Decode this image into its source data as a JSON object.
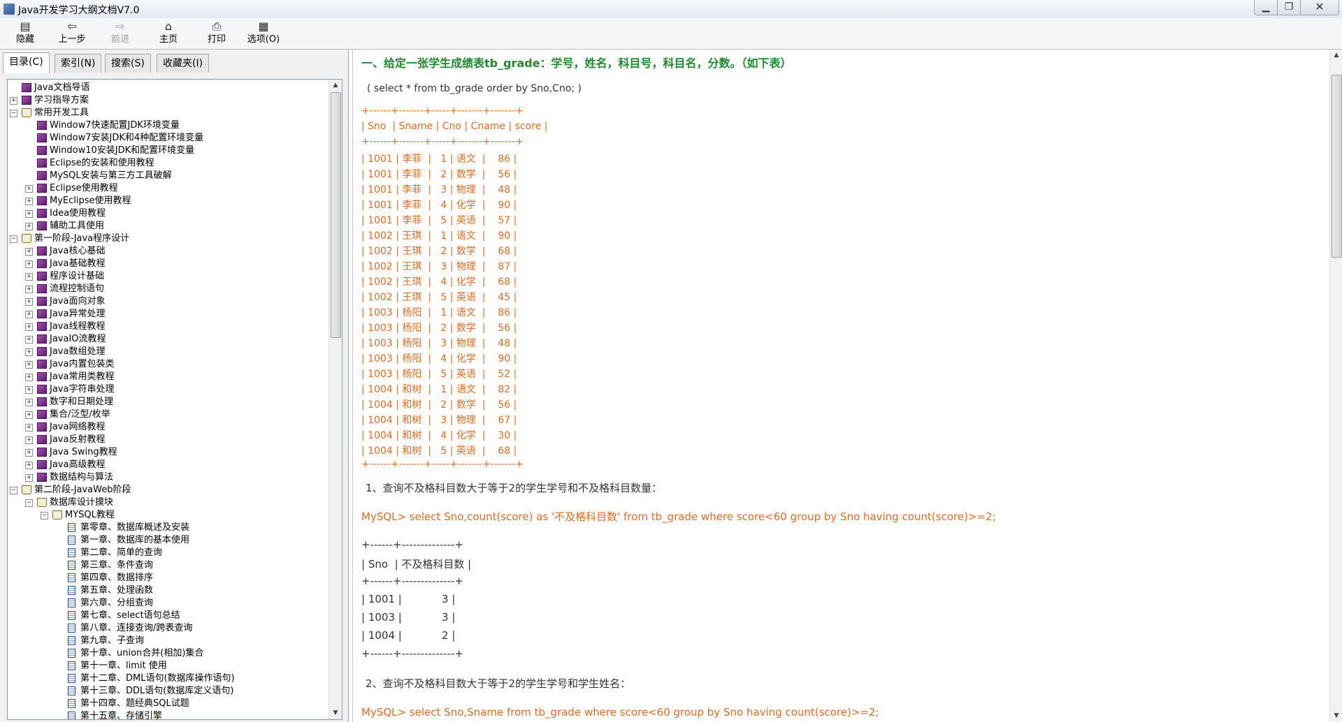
{
  "window": {
    "title": "Java开发学习大纲文档V7.0",
    "min": "▁",
    "max": "❐",
    "close": "✕"
  },
  "toolbar": [
    {
      "label": "隐藏",
      "icon": "▤",
      "enabled": true
    },
    {
      "label": "上一步",
      "icon": "⇦",
      "enabled": true
    },
    {
      "label": "前进",
      "icon": "⇨",
      "enabled": false
    },
    {
      "label": "主页",
      "icon": "⌂",
      "enabled": true
    },
    {
      "label": "打印",
      "icon": "⎙",
      "enabled": true
    },
    {
      "label": "选项(O)",
      "icon": "▦",
      "enabled": true
    }
  ],
  "nav_tabs": [
    {
      "label": "目录(C)",
      "active": true
    },
    {
      "label": "索引(N)",
      "active": false
    },
    {
      "label": "搜索(S)",
      "active": false
    },
    {
      "label": "收藏夹(I)",
      "active": false
    }
  ],
  "tree": [
    {
      "label": "Java文档导语",
      "level": 0,
      "toggle": "",
      "icon": "book"
    },
    {
      "label": "学习指导方案",
      "level": 0,
      "toggle": "+",
      "icon": "book"
    },
    {
      "label": "常用开发工具",
      "level": 0,
      "toggle": "-",
      "icon": "open"
    },
    {
      "label": "Window7快速配置JDK环境变量",
      "level": 1,
      "toggle": "",
      "icon": "book"
    },
    {
      "label": "Window7安装JDK和4种配置环境变量",
      "level": 1,
      "toggle": "",
      "icon": "book"
    },
    {
      "label": "Window10安装JDK和配置环境变量",
      "level": 1,
      "toggle": "",
      "icon": "book"
    },
    {
      "label": "Eclipse的安装和使用教程",
      "level": 1,
      "toggle": "",
      "icon": "book"
    },
    {
      "label": "MySQL安装与第三方工具破解",
      "level": 1,
      "toggle": "",
      "icon": "book"
    },
    {
      "label": "Eclipse使用教程",
      "level": 1,
      "toggle": "+",
      "icon": "book"
    },
    {
      "label": "MyEclipse使用教程",
      "level": 1,
      "toggle": "+",
      "icon": "book"
    },
    {
      "label": "Idea使用教程",
      "level": 1,
      "toggle": "+",
      "icon": "book"
    },
    {
      "label": "辅助工具使用",
      "level": 1,
      "toggle": "+",
      "icon": "book"
    },
    {
      "label": "第一阶段-Java程序设计",
      "level": 0,
      "toggle": "-",
      "icon": "open"
    },
    {
      "label": "Java核心基础",
      "level": 1,
      "toggle": "+",
      "icon": "book"
    },
    {
      "label": "Java基础教程",
      "level": 1,
      "toggle": "+",
      "icon": "book"
    },
    {
      "label": "程序设计基础",
      "level": 1,
      "toggle": "+",
      "icon": "book"
    },
    {
      "label": "流程控制语句",
      "level": 1,
      "toggle": "+",
      "icon": "book"
    },
    {
      "label": "Java面向对象",
      "level": 1,
      "toggle": "+",
      "icon": "book"
    },
    {
      "label": "Java异常处理",
      "level": 1,
      "toggle": "+",
      "icon": "book"
    },
    {
      "label": "Java线程教程",
      "level": 1,
      "toggle": "+",
      "icon": "book"
    },
    {
      "label": "JavaIO流教程",
      "level": 1,
      "toggle": "+",
      "icon": "book"
    },
    {
      "label": "Java数组处理",
      "level": 1,
      "toggle": "+",
      "icon": "book"
    },
    {
      "label": "Java内置包装类",
      "level": 1,
      "toggle": "+",
      "icon": "book"
    },
    {
      "label": "Java常用类教程",
      "level": 1,
      "toggle": "+",
      "icon": "book"
    },
    {
      "label": "Java字符串处理",
      "level": 1,
      "toggle": "+",
      "icon": "book"
    },
    {
      "label": "数字和日期处理",
      "level": 1,
      "toggle": "+",
      "icon": "book"
    },
    {
      "label": "集合/泛型/枚举",
      "level": 1,
      "toggle": "+",
      "icon": "book"
    },
    {
      "label": "Java网络教程",
      "level": 1,
      "toggle": "+",
      "icon": "book"
    },
    {
      "label": "Java反射教程",
      "level": 1,
      "toggle": "+",
      "icon": "book"
    },
    {
      "label": "Java Swing教程",
      "level": 1,
      "toggle": "+",
      "icon": "book"
    },
    {
      "label": "Java高级教程",
      "level": 1,
      "toggle": "+",
      "icon": "book"
    },
    {
      "label": "数据结构与算法",
      "level": 1,
      "toggle": "+",
      "icon": "book"
    },
    {
      "label": "第二阶段-JavaWeb阶段",
      "level": 0,
      "toggle": "-",
      "icon": "open"
    },
    {
      "label": "数据库设计摸块",
      "level": 1,
      "toggle": "-",
      "icon": "open"
    },
    {
      "label": "MYSQL教程",
      "level": 2,
      "toggle": "-",
      "icon": "open"
    },
    {
      "label": "第零章、数据库概述及安装",
      "level": 3,
      "toggle": "",
      "icon": "page"
    },
    {
      "label": "第一章、数据库的基本使用",
      "level": 3,
      "toggle": "",
      "icon": "page"
    },
    {
      "label": "第二章、简单的查询",
      "level": 3,
      "toggle": "",
      "icon": "page"
    },
    {
      "label": "第三章、条件查询",
      "level": 3,
      "toggle": "",
      "icon": "page"
    },
    {
      "label": "第四章、数据排序",
      "level": 3,
      "toggle": "",
      "icon": "page"
    },
    {
      "label": "第五章、处理函数",
      "level": 3,
      "toggle": "",
      "icon": "page"
    },
    {
      "label": "第六章、分组查询",
      "level": 3,
      "toggle": "",
      "icon": "page"
    },
    {
      "label": "第七章、select语句总结",
      "level": 3,
      "toggle": "",
      "icon": "page"
    },
    {
      "label": "第八章、连接查询/跨表查询",
      "level": 3,
      "toggle": "",
      "icon": "page"
    },
    {
      "label": "第九章、子查询",
      "level": 3,
      "toggle": "",
      "icon": "page"
    },
    {
      "label": "第十章、union合并(相加)集合",
      "level": 3,
      "toggle": "",
      "icon": "page"
    },
    {
      "label": "第十一章、limit 使用",
      "level": 3,
      "toggle": "",
      "icon": "page"
    },
    {
      "label": "第十二章、DML语句(数据库操作语句)",
      "level": 3,
      "toggle": "",
      "icon": "page"
    },
    {
      "label": "第十三章、DDL语句(数据库定义语句)",
      "level": 3,
      "toggle": "",
      "icon": "page"
    },
    {
      "label": "第十四章、题经典SQL试题",
      "level": 3,
      "toggle": "",
      "icon": "page"
    },
    {
      "label": "第十五章、存储引擎",
      "level": 3,
      "toggle": "",
      "icon": "page"
    }
  ],
  "content": {
    "heading": "一、给定一张学生成绩表tb_grade：学号，姓名，科目号，科目名，分数。（如下表）",
    "sql_hint": "( select * from tb_grade order by Sno,Cno; )",
    "grade_table": {
      "border": "+------+-------+-----+-------+-------+",
      "header": "| Sno  | Sname | Cno | Cname | score |",
      "rows": [
        "| 1001 | 李菲  |   1 | 语文  |    86 |",
        "| 1001 | 李菲  |   2 | 数学  |    56 |",
        "| 1001 | 李菲  |   3 | 物理  |    48 |",
        "| 1001 | 李菲  |   4 | 化学  |    90 |",
        "| 1001 | 李菲  |   5 | 英语  |    57 |",
        "| 1002 | 王琪  |   1 | 语文  |    90 |",
        "| 1002 | 王琪  |   2 | 数学  |    68 |",
        "| 1002 | 王琪  |   3 | 物理  |    87 |",
        "| 1002 | 王琪  |   4 | 化学  |    68 |",
        "| 1002 | 王琪  |   5 | 英语  |    45 |",
        "| 1003 | 杨阳  |   1 | 语文  |    86 |",
        "| 1003 | 杨阳  |   2 | 数学  |    56 |",
        "| 1003 | 杨阳  |   3 | 物理  |    48 |",
        "| 1003 | 杨阳  |   4 | 化学  |    90 |",
        "| 1003 | 杨阳  |   5 | 英语  |    52 |",
        "| 1004 | 和树  |   1 | 语文  |    82 |",
        "| 1004 | 和树  |   2 | 数学  |    56 |",
        "| 1004 | 和树  |   3 | 物理  |    67 |",
        "| 1004 | 和树  |   4 | 化学  |    30 |",
        "| 1004 | 和树  |   5 | 英语  |    68 |"
      ]
    },
    "q1": {
      "text": "1、查询不及格科目数大于等于2的学生学号和不及格科目数量：",
      "sql": "MySQL> select Sno,count(score) as '不及格科目数' from tb_grade where score<60 group by Sno having count(score)>=2;",
      "border": "+------+--------------+",
      "header": "| Sno  | 不及格科目数 |",
      "rows": [
        "| 1001 |            3 |",
        "| 1003 |            3 |",
        "| 1004 |            2 |"
      ]
    },
    "q2": {
      "text": "2、查询不及格科目数大于等于2的学生学号和学生姓名：",
      "sql": "MySQL> select Sno,Sname from tb_grade where score<60 group by Sno having count(score)>=2;"
    }
  },
  "colors": {
    "heading": "#1a8a2a",
    "sql": "#e86a1c"
  }
}
